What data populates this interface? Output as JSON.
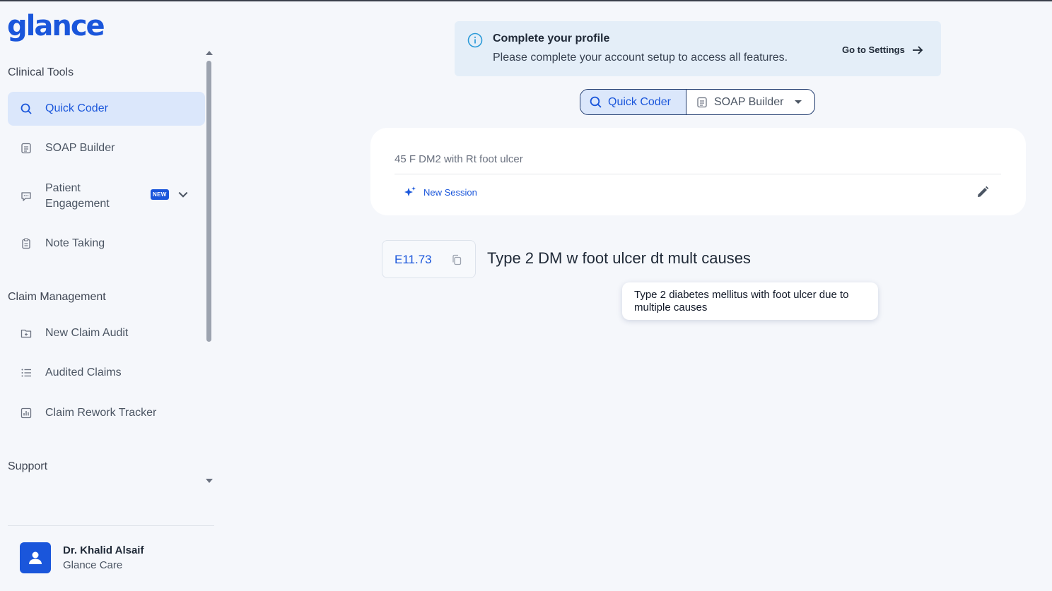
{
  "app": {
    "logo": "glance"
  },
  "sidebar": {
    "sections": [
      {
        "title": "Clinical Tools"
      },
      {
        "title": "Claim Management"
      },
      {
        "title": "Support"
      }
    ],
    "items": [
      {
        "label": "Quick Coder",
        "icon": "search-icon",
        "active": true
      },
      {
        "label": "SOAP Builder",
        "icon": "document-icon"
      },
      {
        "label": "Patient Engagement",
        "icon": "chat-icon",
        "badge": "NEW"
      },
      {
        "label": "Note Taking",
        "icon": "clipboard-icon"
      },
      {
        "label": "New Claim Audit",
        "icon": "folder-plus-icon"
      },
      {
        "label": "Audited Claims",
        "icon": "list-icon"
      },
      {
        "label": "Claim Rework Tracker",
        "icon": "chart-icon"
      }
    ],
    "user": {
      "name": "Dr. Khalid Alsaif",
      "org": "Glance Care"
    }
  },
  "banner": {
    "title": "Complete your profile",
    "text": "Please complete your account setup to access all features.",
    "link": "Go to Settings"
  },
  "toggle": {
    "active": "Quick Coder",
    "other": "SOAP Builder"
  },
  "session": {
    "input": "45 F DM2 with Rt foot ulcer",
    "new_session": "New Session"
  },
  "result": {
    "code": "E11.73",
    "description": "Type 2 DM w foot ulcer dt mult causes",
    "tooltip": "Type 2 diabetes mellitus with foot ulcer due to multiple causes"
  },
  "colors": {
    "accent": "#1a56db",
    "active_bg": "#dbe7fb",
    "banner_bg": "#e4eef8"
  }
}
